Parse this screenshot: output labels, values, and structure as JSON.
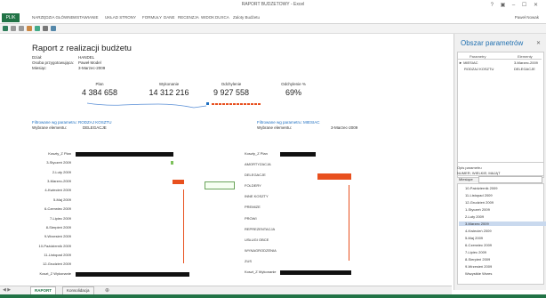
{
  "window": {
    "title": "RAPORT BUDZETOWY - Excel",
    "controls": "? ▣ – ☐ ✕"
  },
  "ribbon": {
    "file": "PLIK",
    "tabs": [
      "NARZĘDZIA GŁÓWNE",
      "WSTAWIANIE",
      "UKŁAD STRONY",
      "FORMUŁY",
      "DANE",
      "RECENZJA",
      "WIDOK",
      "DUXCA",
      "Zaloty Budżetu"
    ],
    "user": "Paweł Nowak"
  },
  "report": {
    "title": "Raport z realizacji budżetu",
    "meta": [
      {
        "label": "Dział:",
        "value": "HANDEL"
      },
      {
        "label": "Osoba przygotowująca:",
        "value": "Paweł Model"
      },
      {
        "label": "Miesiąc:",
        "value": "3-Marzec-2009"
      }
    ],
    "kpis": [
      {
        "label": "Plan",
        "value": "4 384 658"
      },
      {
        "label": "Wykonanie",
        "value": "14 312 216"
      },
      {
        "label": "Odchylenie",
        "value": "9 927 558"
      },
      {
        "label": "Odchylenie %",
        "value": "69%"
      }
    ],
    "left_panel": {
      "filter": "Filtrowane wg parametru: RODZAJ KOSZTU",
      "sel_label": "Wybrane elementu:",
      "sel_value": "DELEGACJE",
      "rows": [
        "Koszty_Z Plan",
        "3-Styczeń 2009",
        "2-Luty 2009",
        "3-Marzec-2009",
        "4-Kwiecień 2009",
        "5-Maj 2009",
        "6-Czerwiec 2009",
        "7-Lipiec 2009",
        "8-Sierpień 2009",
        "9-Wrzesień 2009",
        "10-Październik 2009",
        "11-Listopad 2009",
        "12-Grudzień 2009",
        "Koszt_Z Wykonanie"
      ]
    },
    "right_panel": {
      "filter": "Filtrowane wg parametru: MIESIAC",
      "sel_label": "Wybrane elementu:",
      "sel_value": "3-Marzec-2009",
      "rows": [
        "Koszty_Z Plan",
        "AMORTYZACJA",
        "DELEGACJE",
        "FOLDERY",
        "INNE KOSZTY",
        "PREMIZE",
        "PROWI",
        "REPREZENTACJA",
        "USŁUGI OBCE",
        "WYNAGRODZENIA",
        "ZUS",
        "Koszt_Z Wykonanie"
      ]
    }
  },
  "pane": {
    "title": "Obszar parametrów",
    "col1": "Parametry",
    "col2": "Elementy",
    "rows": [
      {
        "k": "► MIESIAC",
        "v": "3-Marzec-2009"
      },
      {
        "k": "RODZAJ KOSZTU",
        "v": "DELEGACJE"
      }
    ],
    "sel_hdr": "Opis parametru",
    "sel_val": "NUMER; WIELKIE; MAJĄT",
    "list_label": "Miesiące",
    "list": [
      "10-Październik 2009",
      "11-Listopad 2009",
      "12-Grudzień 2009",
      "1-Styczeń 2009",
      "2-Luty 2009",
      "3-Marzec 2009",
      "4-Kwiecień 2009",
      "5-Maj 2009",
      "6-Czerwiec 2009",
      "7-Lipiec 2009",
      "8-Sierpień 2009",
      "9-Wrzesień 2009",
      "Wszystkie Wrzes"
    ]
  },
  "sheets": [
    "RAPORT",
    "Konsolidacja"
  ],
  "colors": {
    "accent": "#217346",
    "red": "#e8501e",
    "blue": "#1e6fc1"
  }
}
